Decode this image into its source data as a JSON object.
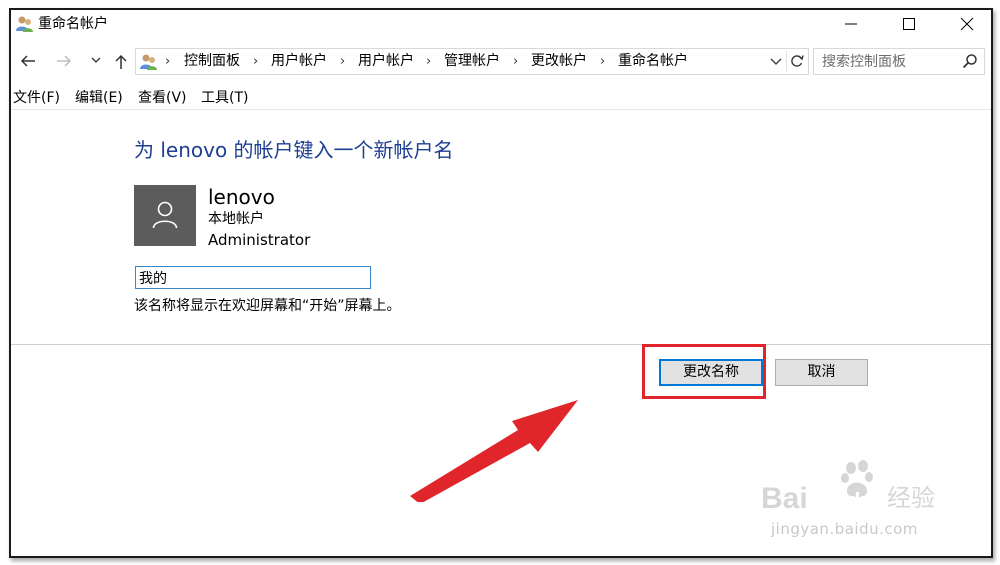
{
  "window": {
    "title": "重命名帐户",
    "icon": "users-icon",
    "controls": [
      "minimize-icon",
      "maximize-icon",
      "close-icon"
    ]
  },
  "navigation": {
    "back_icon": "arrow-left-icon",
    "forward_icon": "arrow-right-icon",
    "recent_icon": "chevron-down-icon",
    "up_icon": "arrow-up-icon",
    "breadcrumb": [
      "控制面板",
      "用户帐户",
      "用户帐户",
      "管理帐户",
      "更改帐户",
      "重命名帐户"
    ],
    "search_placeholder": "搜索控制面板"
  },
  "menu": [
    "文件(F)",
    "编辑(E)",
    "查看(V)",
    "工具(T)"
  ],
  "content": {
    "heading": "为 lenovo 的帐户键入一个新帐户名",
    "user": {
      "name": "lenovo",
      "type": "本地帐户",
      "role": "Administrator",
      "avatar_icon": "user-icon"
    },
    "new_name_value": "我的",
    "hint": "该名称将显示在欢迎屏幕和“开始”屏幕上。"
  },
  "buttons": {
    "rename": "更改名称",
    "cancel": "取消"
  },
  "colors": {
    "heading": "#1e3f93",
    "input_border": "#3a86c8",
    "primary_button_border": "#0078d7",
    "annotation_red": "#e0252b"
  },
  "watermark": {
    "logo": "Bai du 经验",
    "url": "jingyan.baidu.com"
  }
}
